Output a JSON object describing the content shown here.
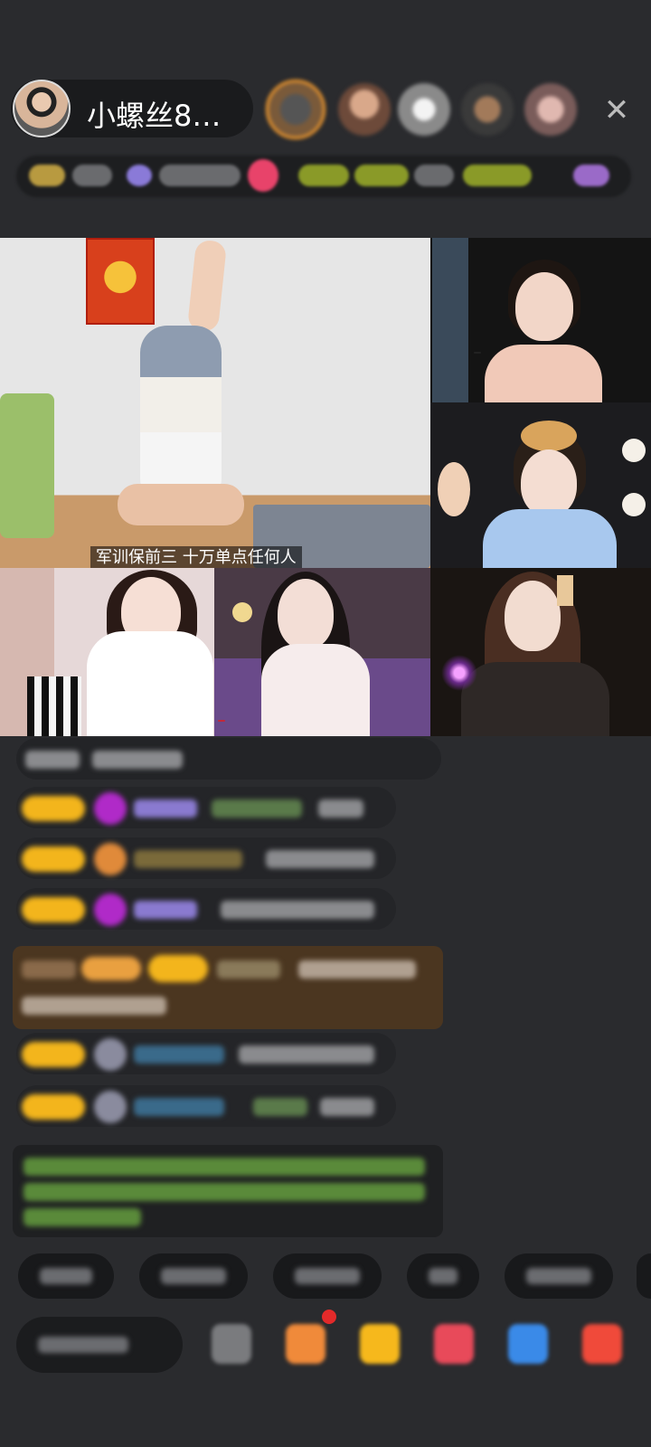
{
  "header": {
    "host_name": "小螺丝8…",
    "close_icon": "✕"
  },
  "main_video": {
    "caption": "军训保前三  十万单点任何人"
  },
  "colors": {
    "background": "#2a2b2e",
    "badge": "#f3b51c",
    "system_message": "#4b3620",
    "notice_text": "#8ccf6a"
  }
}
